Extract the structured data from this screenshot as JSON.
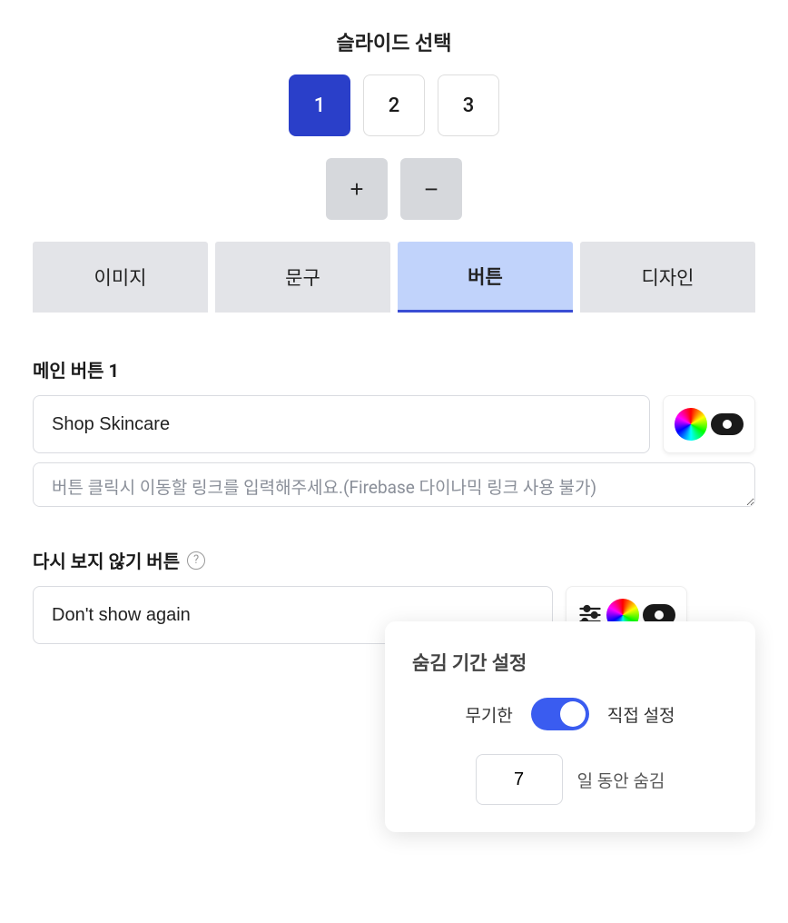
{
  "slideSelect": {
    "title": "슬라이드 선택",
    "numbers": [
      "1",
      "2",
      "3"
    ],
    "activeIndex": 0,
    "addLabel": "+",
    "removeLabel": "−"
  },
  "tabs": {
    "items": [
      "이미지",
      "문구",
      "버튼",
      "디자인"
    ],
    "activeIndex": 2
  },
  "mainButton": {
    "label": "메인 버튼 1",
    "value": "Shop Skincare",
    "linkPlaceholder": "버튼 클릭시 이동할 링크를 입력해주세요.(Firebase 다이나믹 링크 사용 불가)"
  },
  "dontShowButton": {
    "label": "다시 보지 않기 버튼",
    "value": "Don't show again"
  },
  "hidePeriod": {
    "title": "숨김 기간 설정",
    "leftLabel": "무기한",
    "rightLabel": "직접 설정",
    "daysValue": "7",
    "daysSuffix": "일 동안 숨김"
  }
}
